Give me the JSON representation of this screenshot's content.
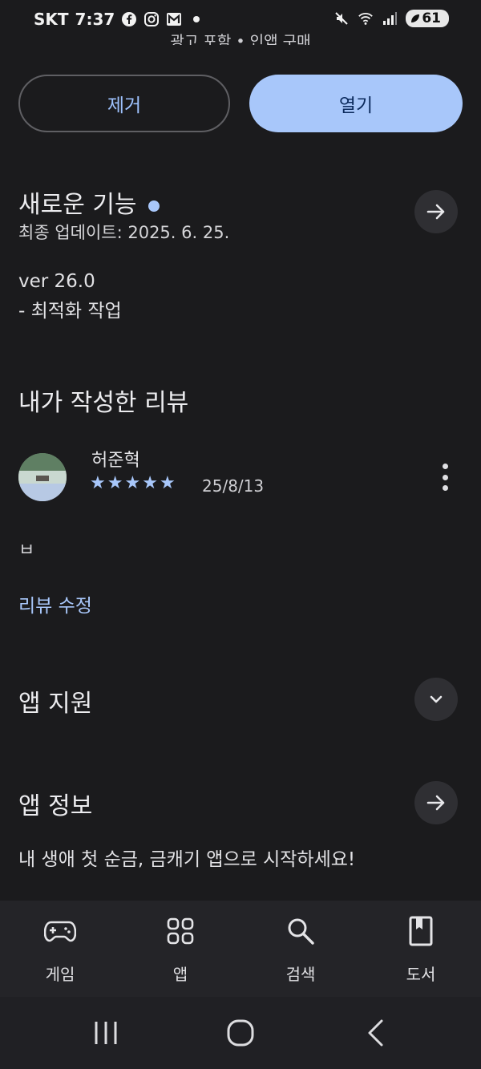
{
  "status_bar": {
    "carrier": "SKT",
    "time": "7:37",
    "battery": "61"
  },
  "top_cut_text": "광고 포함 • 인앱 구매",
  "actions": {
    "remove_label": "제거",
    "open_label": "열기"
  },
  "whats_new": {
    "title": "새로운 기능",
    "last_updated": "최종 업데이트: 2025. 6. 25.",
    "version": "ver 26.0",
    "notes": "- 최적화 작업"
  },
  "my_review": {
    "title": "내가 작성한 리뷰",
    "reviewer_name": "허준혁",
    "rating": 5,
    "date": "25/8/13",
    "body": "ㅂ",
    "edit_label": "리뷰 수정"
  },
  "app_support": {
    "title": "앱 지원"
  },
  "app_info": {
    "title": "앱 정보",
    "description": "내 생애 첫 순금, 금캐기 앱으로 시작하세요!"
  },
  "bottom_nav": {
    "items": [
      {
        "label": "게임",
        "icon": "gamepad-icon"
      },
      {
        "label": "앱",
        "icon": "apps-grid-icon"
      },
      {
        "label": "검색",
        "icon": "search-icon"
      },
      {
        "label": "도서",
        "icon": "book-icon"
      }
    ]
  },
  "colors": {
    "accent": "#a8c7fa",
    "background": "#1b1b1d",
    "nav_background": "#242428"
  }
}
